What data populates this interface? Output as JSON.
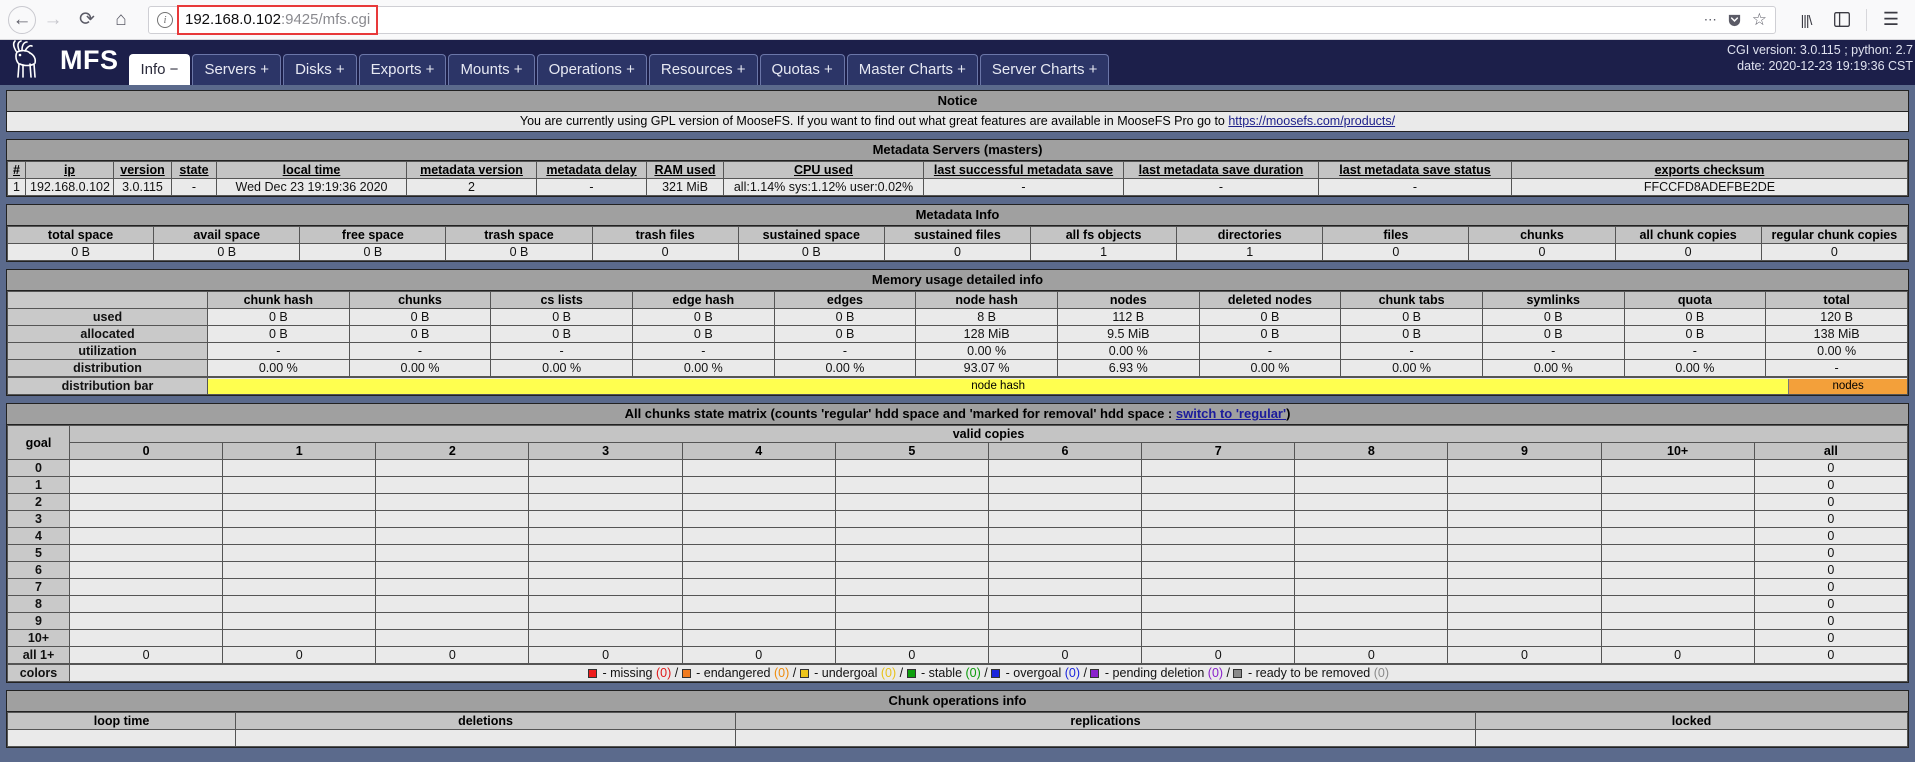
{
  "browser": {
    "url_main": "192.168.0.102",
    "url_dim": ":9425/mfs.cgi",
    "back_icon": "←",
    "forward_icon": "→",
    "reload_icon": "⟳",
    "home_icon": "⌂",
    "info_icon": "i",
    "more_icon": "⋯",
    "shield_icon": "▼",
    "bookmark_icon": "☆",
    "library_icon": "|||\\",
    "sidebar_icon": "▣",
    "menu_icon": "☰"
  },
  "header": {
    "logo_text": "MFS",
    "nav": [
      {
        "label": "Info −",
        "active": true
      },
      {
        "label": "Servers +",
        "active": false
      },
      {
        "label": "Disks +",
        "active": false
      },
      {
        "label": "Exports +",
        "active": false
      },
      {
        "label": "Mounts +",
        "active": false
      },
      {
        "label": "Operations +",
        "active": false
      },
      {
        "label": "Resources +",
        "active": false
      },
      {
        "label": "Quotas +",
        "active": false
      },
      {
        "label": "Master Charts +",
        "active": false
      },
      {
        "label": "Server Charts +",
        "active": false
      }
    ],
    "version_line1": "CGI version: 3.0.115 ; python: 2.7",
    "version_line2": "date: 2020-12-23 19:19:36 CST"
  },
  "notice": {
    "title": "Notice",
    "text_before": "You are currently using GPL version of MooseFS. If you want to find out what great features are available in MooseFS Pro go to ",
    "link": "https://moosefs.com/products/"
  },
  "metadata_servers": {
    "title": "Metadata Servers (masters)",
    "columns": [
      "#",
      "ip",
      "version",
      "state",
      "local time",
      "metadata version",
      "metadata delay",
      "RAM used",
      "CPU used",
      "last successful metadata save",
      "last metadata save duration",
      "last metadata save status",
      "exports checksum"
    ],
    "rows": [
      {
        "index": "1",
        "ip": "192.168.0.102",
        "version": "3.0.115",
        "state": "-",
        "local_time": "Wed Dec 23 19:19:36 2020",
        "metadata_version": "2",
        "metadata_delay": "-",
        "ram_used": "321 MiB",
        "cpu_used": "all:1.14% sys:1.12% user:0.02%",
        "last_successful_metadata_save": "-",
        "last_metadata_save_duration": "-",
        "last_metadata_save_status": "-",
        "exports_checksum": "FFCCFD8ADEFBE2DE"
      }
    ]
  },
  "metadata_info": {
    "title": "Metadata Info",
    "columns": [
      "total space",
      "avail space",
      "free space",
      "trash space",
      "trash files",
      "sustained space",
      "sustained files",
      "all fs objects",
      "directories",
      "files",
      "chunks",
      "all chunk copies",
      "regular chunk copies"
    ],
    "values": [
      "0 B",
      "0 B",
      "0 B",
      "0 B",
      "0",
      "0 B",
      "0",
      "1",
      "1",
      "0",
      "0",
      "0",
      "0"
    ]
  },
  "memory_usage": {
    "title": "Memory usage detailed info",
    "columns": [
      "",
      "chunk hash",
      "chunks",
      "cs lists",
      "edge hash",
      "edges",
      "node hash",
      "nodes",
      "deleted nodes",
      "chunk tabs",
      "symlinks",
      "quota",
      "total"
    ],
    "rows": [
      {
        "label": "used",
        "values": [
          "0 B",
          "0 B",
          "0 B",
          "0 B",
          "0 B",
          "8 B",
          "112 B",
          "0 B",
          "0 B",
          "0 B",
          "0 B",
          "120 B"
        ]
      },
      {
        "label": "allocated",
        "values": [
          "0 B",
          "0 B",
          "0 B",
          "0 B",
          "0 B",
          "128 MiB",
          "9.5 MiB",
          "0 B",
          "0 B",
          "0 B",
          "0 B",
          "138 MiB"
        ]
      },
      {
        "label": "utilization",
        "values": [
          "-",
          "-",
          "-",
          "-",
          "-",
          "0.00 %",
          "0.00 %",
          "-",
          "-",
          "-",
          "-",
          "0.00 %"
        ]
      },
      {
        "label": "distribution",
        "values": [
          "0.00 %",
          "0.00 %",
          "0.00 %",
          "0.00 %",
          "0.00 %",
          "93.07 %",
          "6.93 %",
          "0.00 %",
          "0.00 %",
          "0.00 %",
          "0.00 %",
          "-"
        ]
      }
    ],
    "bar_label": "distribution bar",
    "bar_segments": [
      {
        "label": "node hash",
        "pct": 93.07,
        "color": "#ffff4f"
      },
      {
        "label": "nodes",
        "pct": 6.93,
        "color": "#f3a03a"
      }
    ]
  },
  "chunk_matrix": {
    "title_before": "All chunks state matrix (counts 'regular' hdd space and 'marked for removal' hdd space : ",
    "title_link": "switch to 'regular'",
    "title_after": ")",
    "goal_label": "goal",
    "valid_copies_label": "valid copies",
    "copy_columns": [
      "0",
      "1",
      "2",
      "3",
      "4",
      "5",
      "6",
      "7",
      "8",
      "9",
      "10+",
      "all"
    ],
    "goal_rows": [
      "0",
      "1",
      "2",
      "3",
      "4",
      "5",
      "6",
      "7",
      "8",
      "9",
      "10+"
    ],
    "goal_row_totals": [
      "0",
      "0",
      "0",
      "0",
      "0",
      "0",
      "0",
      "0",
      "0",
      "0",
      "0"
    ],
    "all_label": "all 1+",
    "all_values": [
      "0",
      "0",
      "0",
      "0",
      "0",
      "0",
      "0",
      "0",
      "0",
      "0",
      "0",
      "0"
    ],
    "colors_label": "colors",
    "legend": [
      {
        "color": "#ee1c1c",
        "text": "- missing",
        "count": "(0)",
        "cls": "cm"
      },
      {
        "color": "#f07b20",
        "text": "- endangered",
        "count": "(0)",
        "cls": "ce"
      },
      {
        "color": "#eec51c",
        "text": "- undergoal",
        "count": "(0)",
        "cls": "cu"
      },
      {
        "color": "#0ea00e",
        "text": "- stable",
        "count": "(0)",
        "cls": "cs"
      },
      {
        "color": "#1a25dd",
        "text": "- overgoal",
        "count": "(0)",
        "cls": "co"
      },
      {
        "color": "#8a21cc",
        "text": "- pending deletion",
        "count": "(0)",
        "cls": "cp"
      },
      {
        "color": "#8b8b8b",
        "text": "- ready to be removed",
        "count": "(0)",
        "cls": "cr"
      }
    ]
  },
  "chunk_operations": {
    "title": "Chunk operations info",
    "columns": [
      "loop time",
      "deletions",
      "replications",
      "locked"
    ]
  }
}
